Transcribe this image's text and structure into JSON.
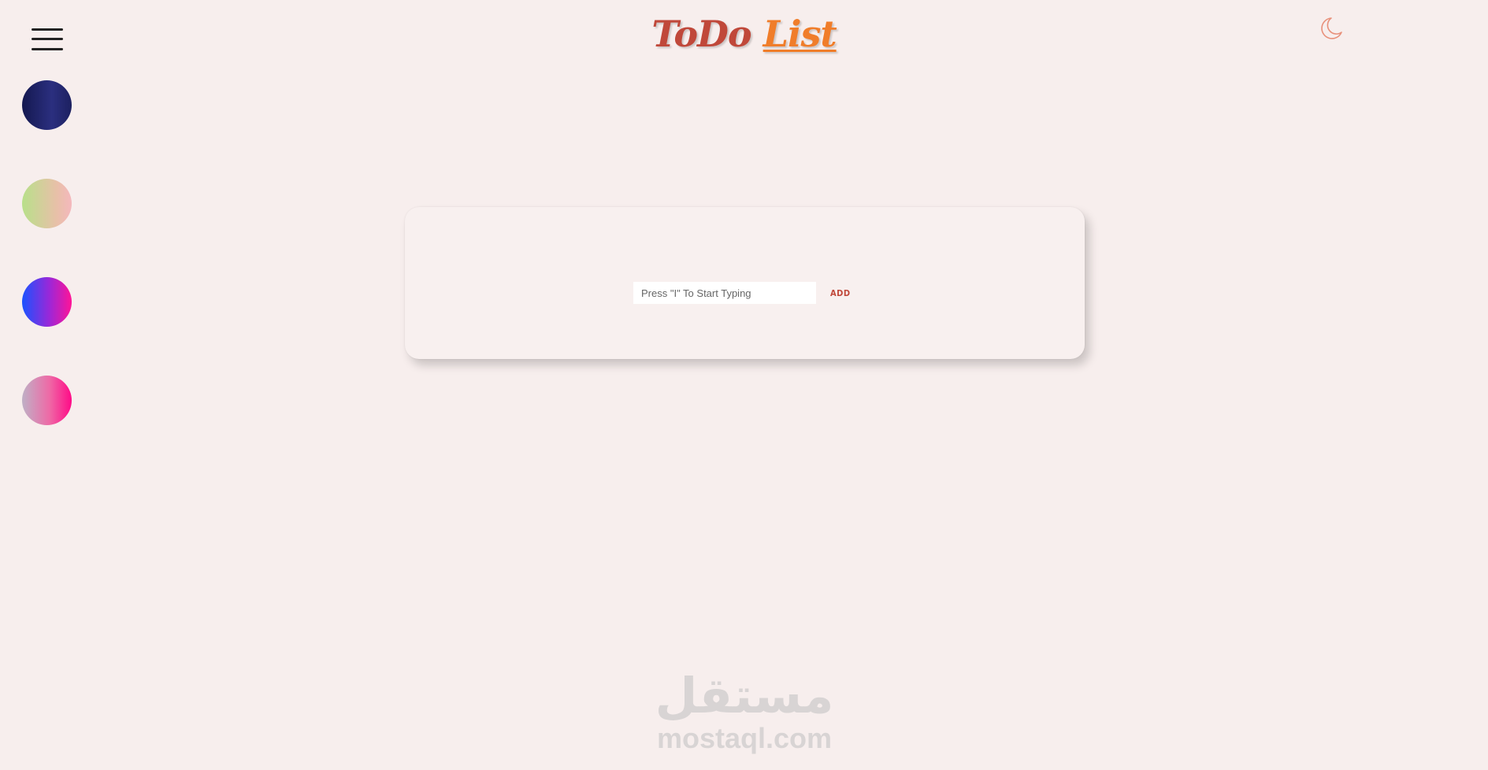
{
  "app": {
    "title_part1": "ToDo",
    "title_part2": "List"
  },
  "menu": {
    "icon": "hamburger-menu-icon"
  },
  "theme": {
    "icon": "moon-icon",
    "icon_color": "#e8907a"
  },
  "swatches": [
    {
      "name": "navy",
      "colors": [
        "#141850",
        "#2b2f7f"
      ]
    },
    {
      "name": "lime-peach",
      "colors": [
        "#b8e08a",
        "#f4b8bd"
      ]
    },
    {
      "name": "blue-magenta",
      "colors": [
        "#1a53ff",
        "#ff1497"
      ]
    },
    {
      "name": "mauve-pink",
      "colors": [
        "#bfb0c6",
        "#ff0a87"
      ]
    }
  ],
  "todo": {
    "input_placeholder": "Press \"I\" To Start Typing",
    "input_value": "",
    "add_label": "ADD"
  },
  "watermark": {
    "arabic": "مستقل",
    "latin": "mostaql.com"
  },
  "colors": {
    "background": "#f7eeed",
    "accent_red": "#c0483a",
    "accent_orange": "#f07d2a"
  }
}
